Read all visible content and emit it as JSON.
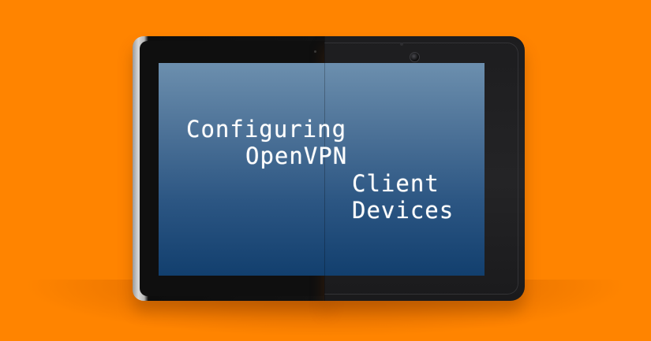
{
  "image": {
    "background_color": "#ff8400",
    "screen_gradient": [
      "#6c8fae",
      "#123f6e"
    ]
  },
  "title": {
    "line1": "Configuring",
    "line2": "OpenVPN",
    "line3": "Client",
    "line4": "Devices"
  },
  "icons": {
    "camera": "camera-icon"
  }
}
